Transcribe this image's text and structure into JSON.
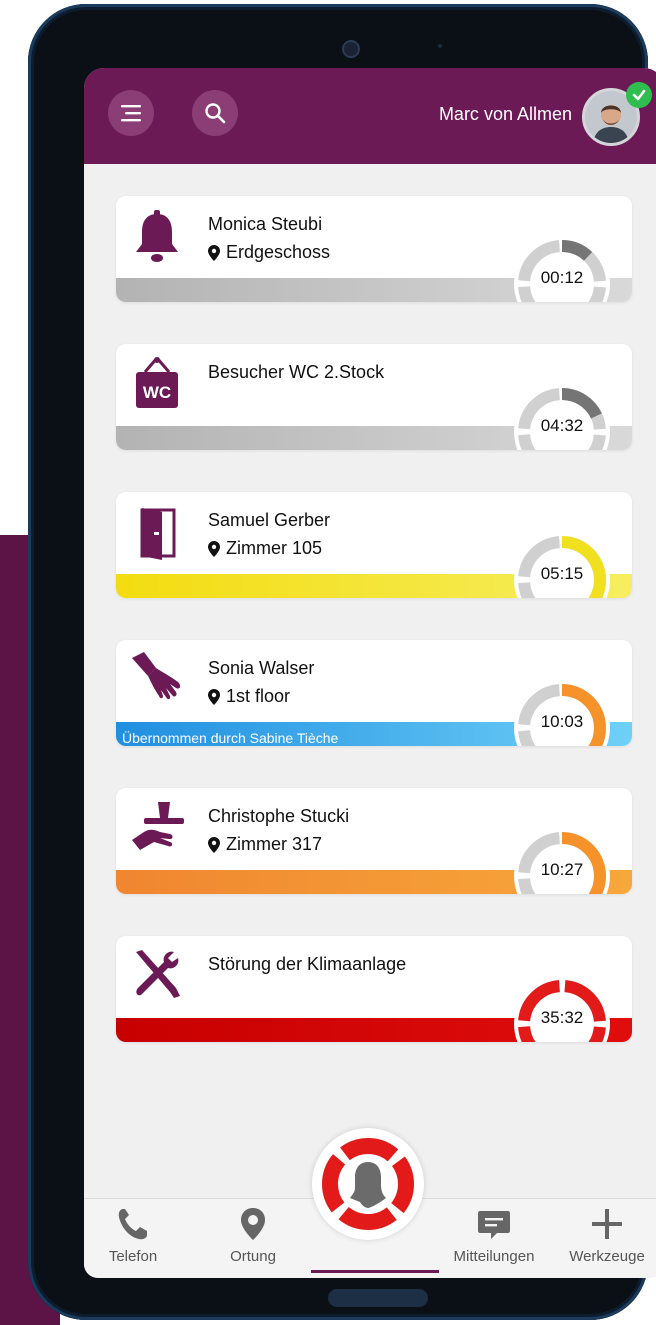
{
  "user": {
    "name": "Marc von Allmen",
    "status": "online"
  },
  "header": {
    "menu_icon": "menu-lines-icon",
    "search_icon": "search-icon"
  },
  "alarms": [
    {
      "name": "Monica Steubi",
      "location": "Erdgeschoss",
      "icon": "bell-icon",
      "time": "00:12",
      "bar_color": "#bdbdbd",
      "ring_color": "#757575",
      "ring_progress": 0.12,
      "note": ""
    },
    {
      "name": "Besucher WC 2.Stock",
      "location": "",
      "icon": "wc-sign-icon",
      "time": "04:32",
      "bar_color": "#bdbdbd",
      "ring_color": "#757575",
      "ring_progress": 0.18,
      "note": ""
    },
    {
      "name": "Samuel Gerber",
      "location": "Zimmer 105",
      "icon": "door-icon",
      "time": "05:15",
      "bar_color": "#f4e320",
      "ring_color": "#f0e020",
      "ring_progress": 0.4,
      "note": ""
    },
    {
      "name": "Sonia Walser",
      "location": "1st floor",
      "icon": "hand-icon",
      "time": "10:03",
      "bar_color": "#2f9fe8",
      "ring_color": "#f5922a",
      "ring_progress": 0.6,
      "note": "Übernommen durch Sabine Tièche"
    },
    {
      "name": "Christophe Stucki",
      "location": "Zimmer 317",
      "icon": "serving-tray-icon",
      "time": "10:27",
      "bar_color": "#f5922a",
      "ring_color": "#f5922a",
      "ring_progress": 0.65,
      "note": ""
    },
    {
      "name": "Störung der Klimaanlage",
      "location": "",
      "icon": "tools-icon",
      "time": "35:32",
      "bar_color": "#d00000",
      "ring_color": "#e21a1a",
      "ring_progress": 1.0,
      "note": ""
    }
  ],
  "nav": [
    {
      "label": "Telefon",
      "icon": "phone-icon"
    },
    {
      "label": "Ortung",
      "icon": "location-pin-icon"
    },
    {
      "label": "",
      "icon": "alarm-bell-icon"
    },
    {
      "label": "Mitteilungen",
      "icon": "message-icon"
    },
    {
      "label": "Werkzeuge",
      "icon": "plus-icon"
    }
  ],
  "colors": {
    "brand": "#6b1a55",
    "background": "#f0f0f0",
    "alarm_red": "#e21a1a"
  }
}
